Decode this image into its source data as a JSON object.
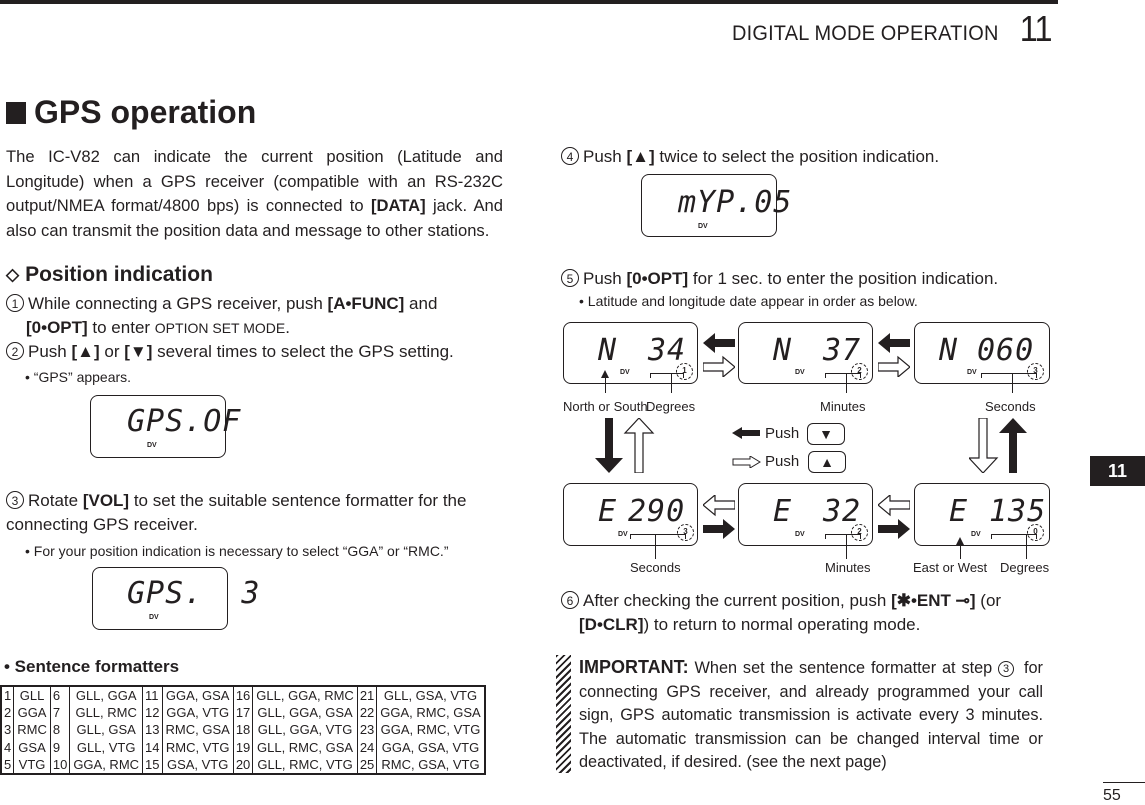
{
  "header": {
    "chapter_title": "DIGITAL MODE OPERATION",
    "chapter_number": "11"
  },
  "section": {
    "title": "GPS operation",
    "intro_before_bold": "The IC-V82 can indicate the current position (Latitude and Longitude) when a GPS receiver (compatible with an RS-232C output/NMEA format/4800 bps) is connected to ",
    "intro_bold": "[DATA]",
    "intro_after_bold": " jack. And also can transmit the position data and message to other stations."
  },
  "subsection": {
    "title": "Position indication"
  },
  "steps": [
    {
      "num": "1",
      "t1": "While connecting a GPS receiver, push ",
      "k1": "[A•FUNC]",
      "t2": " and ",
      "k2": "[0•OPT]",
      "t3": " to enter ",
      "sc": "OPTION SET MODE",
      "t4": "."
    },
    {
      "num": "2",
      "t1": "Push ",
      "k1": "[▲]",
      "t2": " or ",
      "k2": "[▼]",
      "t3": " several times to select the GPS setting.",
      "note": "• “GPS” appears.",
      "lcd": "GPS.OF"
    },
    {
      "num": "3",
      "t1": "Rotate ",
      "k1": "[VOL]",
      "t2": " to set the suitable sentence formatter for the connecting GPS receiver.",
      "note": "• For your position indication is necessary to select “GGA” or “RMC.”",
      "lcd": "GPS.  3"
    },
    {
      "num": "4",
      "t1": "Push ",
      "k1": "[▲]",
      "t2": " twice to select the position indication.",
      "lcd": "mYP.05"
    },
    {
      "num": "5",
      "t1": "Push ",
      "k1": "[0•OPT]",
      "t2": " for 1 sec. to enter the position indication.",
      "note": "• Latitude and longitude date appear in order as below."
    },
    {
      "num": "6",
      "t1": "After checking the current position, push ",
      "k1": "[✱•ENT ⊸]",
      "t2": " (or ",
      "k2": "[D•CLR]",
      "t3": ") to return to normal operating mode."
    }
  ],
  "lcd_dv_label": "DV",
  "position_diagram": {
    "top_row": [
      {
        "hemi": "N",
        "value": "34",
        "label": "Degrees",
        "signal": "1"
      },
      {
        "hemi": "N",
        "value": "37",
        "label": "Minutes",
        "signal": "2"
      },
      {
        "hemi": "N",
        "value": "060",
        "label": "Seconds",
        "signal": "3"
      }
    ],
    "bottom_row": [
      {
        "hemi": "E",
        "value": "290",
        "label": "Seconds",
        "signal": "3"
      },
      {
        "hemi": "E",
        "value": "32",
        "label": "Minutes",
        "signal": "2"
      },
      {
        "hemi": "E",
        "value": "135",
        "label": "Degrees",
        "signal": "0"
      }
    ],
    "north_south_label": "North or South",
    "east_west_label": "East or West",
    "legend": [
      {
        "arrow": "filled",
        "text": "Push",
        "key": "▼"
      },
      {
        "arrow": "outline",
        "text": "Push",
        "key": "▲"
      }
    ]
  },
  "sentence_formatters": {
    "title": "• Sentence formatters",
    "rows": [
      [
        [
          "1",
          "GLL"
        ],
        [
          "6",
          "GLL, GGA"
        ],
        [
          "11",
          "GGA, GSA"
        ],
        [
          "16",
          "GLL, GGA, RMC"
        ],
        [
          "21",
          "GLL, GSA, VTG"
        ]
      ],
      [
        [
          "2",
          "GGA"
        ],
        [
          "7",
          "GLL, RMC"
        ],
        [
          "12",
          "GGA, VTG"
        ],
        [
          "17",
          "GLL, GGA, GSA"
        ],
        [
          "22",
          "GGA, RMC, GSA"
        ]
      ],
      [
        [
          "3",
          "RMC"
        ],
        [
          "8",
          "GLL, GSA"
        ],
        [
          "13",
          "RMC, GSA"
        ],
        [
          "18",
          "GLL, GGA, VTG"
        ],
        [
          "23",
          "GGA, RMC, VTG"
        ]
      ],
      [
        [
          "4",
          "GSA"
        ],
        [
          "9",
          "GLL, VTG"
        ],
        [
          "14",
          "RMC, VTG"
        ],
        [
          "19",
          "GLL, RMC, GSA"
        ],
        [
          "24",
          "GGA, GSA, VTG"
        ]
      ],
      [
        [
          "5",
          "VTG"
        ],
        [
          "10",
          "GGA, RMC"
        ],
        [
          "15",
          "GSA, VTG"
        ],
        [
          "20",
          "GLL, RMC, VTG"
        ],
        [
          "25",
          "RMC, GSA, VTG"
        ]
      ]
    ]
  },
  "important": {
    "label": "IMPORTANT:",
    "text_1": " When set the sentence formatter at step ",
    "step_ref": "3",
    "text_2": " for connecting GPS receiver, and already programmed your call sign, GPS automatic transmission is activate every 3 minutes. The automatic transmission can be changed interval time or deactivated, if desired. (see the next page)"
  },
  "side_tab": "11",
  "page_number": "55"
}
